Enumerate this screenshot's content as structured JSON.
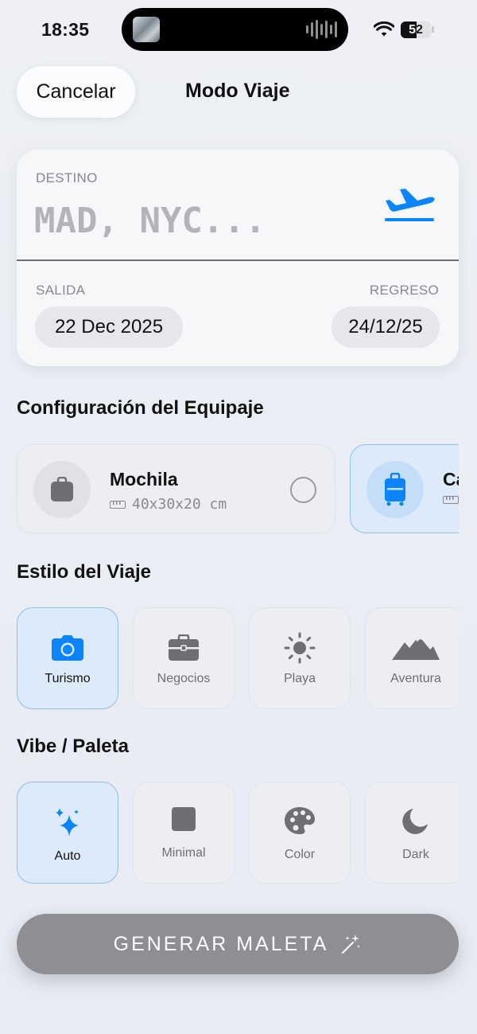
{
  "status_bar": {
    "time": "18:35",
    "battery_level": 52,
    "battery_text": "52"
  },
  "header": {
    "cancel_label": "Cancelar",
    "title": "Modo Viaje"
  },
  "trip": {
    "destination_label": "DESTINO",
    "destination_placeholder": "MAD, NYC...",
    "departure_label": "SALIDA",
    "return_label": "REGRESO",
    "departure_date": "22 Dec 2025",
    "return_date": "24/12/25",
    "icon": "airplane-departure-icon"
  },
  "luggage": {
    "title": "Configuración del Equipaje",
    "options": [
      {
        "name": "Mochila",
        "dims": "40x30x20 cm",
        "icon": "backpack-icon",
        "selected": false
      },
      {
        "name": "Ca",
        "dims": "",
        "icon": "suitcase-icon",
        "selected": true
      }
    ]
  },
  "style": {
    "title": "Estilo del Viaje",
    "options": [
      {
        "label": "Turismo",
        "icon": "camera-icon",
        "selected": true
      },
      {
        "label": "Negocios",
        "icon": "briefcase-icon",
        "selected": false
      },
      {
        "label": "Playa",
        "icon": "sun-icon",
        "selected": false
      },
      {
        "label": "Aventura",
        "icon": "mountains-icon",
        "selected": false
      }
    ]
  },
  "vibe": {
    "title": "Vibe / Paleta",
    "options": [
      {
        "label": "Auto",
        "icon": "sparkles-icon",
        "selected": true
      },
      {
        "label": "Minimal",
        "icon": "square-icon",
        "selected": false
      },
      {
        "label": "Color",
        "icon": "palette-icon",
        "selected": false
      },
      {
        "label": "Dark",
        "icon": "moon-icon",
        "selected": false
      }
    ]
  },
  "generate_button": {
    "label": "GENERAR MALETA",
    "icon": "magic-wand-icon"
  },
  "colors": {
    "accent": "#0a84ff",
    "selected_fill": "#ddeaf9",
    "selected_border": "#8cc0ee",
    "button_gray": "#8e8e93"
  }
}
